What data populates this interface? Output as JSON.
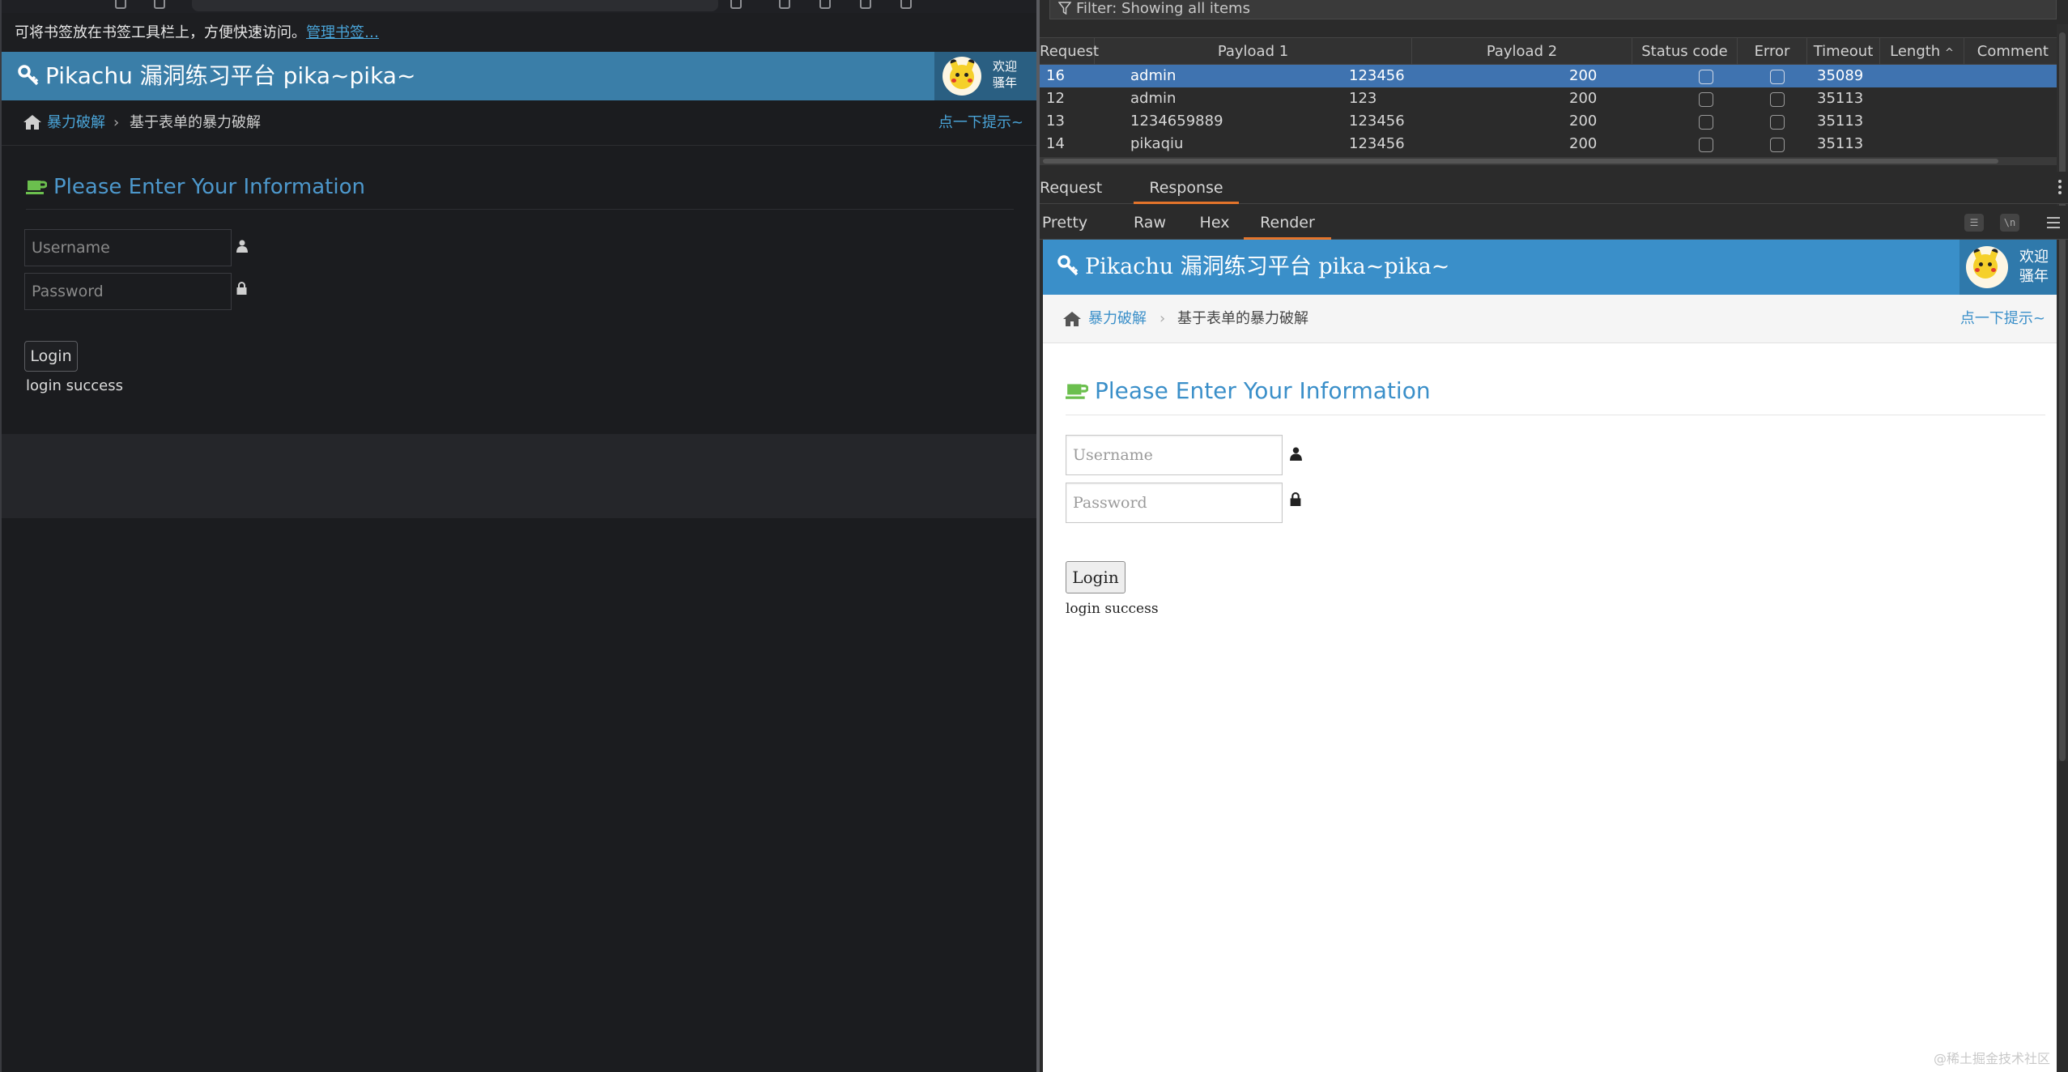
{
  "browser": {
    "bookmark_bar_text": "可将书签放在书签工具栏上，方便快速访问。",
    "bookmark_bar_link": "管理书签…"
  },
  "pikachu": {
    "title": "Pikachu 漏洞练习平台 pika~pika~",
    "welcome_line1": "欢迎",
    "welcome_line2": "骚年",
    "breadcrumb_link": "暴力破解",
    "breadcrumb_sep": "›",
    "breadcrumb_current": "基于表单的暴力破解",
    "hint_link": "点一下提示~",
    "form_title": "Please Enter Your Information",
    "username_placeholder": "Username",
    "password_placeholder": "Password",
    "login_button": "Login",
    "result_message": "login success"
  },
  "burp": {
    "filter_text": "Filter: Showing all items",
    "columns": [
      "Request",
      "Payload 1",
      "Payload 2",
      "Status code",
      "Error",
      "Timeout",
      "Length",
      "Comment"
    ],
    "sort_indicator": "^",
    "rows": [
      {
        "request": "16",
        "payload1": "admin",
        "payload2": "123456",
        "status": "200",
        "length": "35089",
        "selected": true
      },
      {
        "request": "12",
        "payload1": "admin",
        "payload2": "123",
        "status": "200",
        "length": "35113",
        "selected": false
      },
      {
        "request": "13",
        "payload1": "1234659889",
        "payload2": "123456",
        "status": "200",
        "length": "35113",
        "selected": false
      },
      {
        "request": "14",
        "payload1": "pikaqiu",
        "payload2": "123456",
        "status": "200",
        "length": "35113",
        "selected": false
      }
    ],
    "message_tabs": [
      "Request",
      "Response"
    ],
    "active_message_tab": "Response",
    "view_tabs": [
      "Pretty",
      "Raw",
      "Hex",
      "Render"
    ],
    "active_view_tab": "Render",
    "toolbar_wrap_label": "\\n"
  },
  "watermark": "@稀土掘金技术社区",
  "colors": {
    "burp_selection": "#3f73b0",
    "burp_tab_accent": "#e4742b",
    "pikachu_header_dark": "#3a7ea8",
    "pikachu_header_light": "#3a8fc9"
  }
}
